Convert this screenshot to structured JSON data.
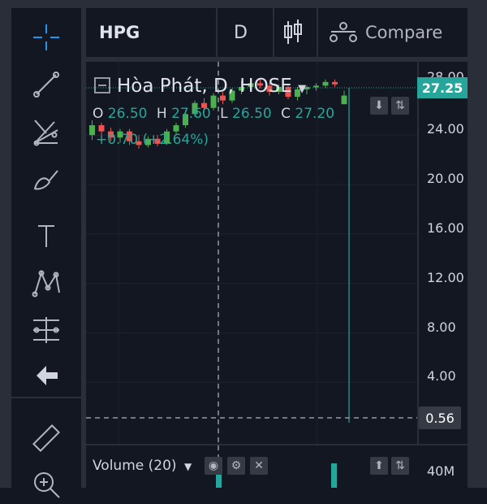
{
  "header": {
    "symbol": "HPG",
    "interval": "D",
    "compare_label": "Compare"
  },
  "legend": {
    "title": "Hòa Phát, D, HOSE",
    "open_key": "O",
    "open": "26.50",
    "high_key": "H",
    "high": "27.60",
    "low_key": "L",
    "low": "26.50",
    "close_key": "C",
    "close": "27.20",
    "change": "+0.70 (+2.64%)"
  },
  "price_axis": {
    "ticks": [
      "28.00",
      "24.00",
      "20.00",
      "16.00",
      "12.00",
      "8.00",
      "4.00"
    ],
    "last_price": "27.25",
    "crosshair_price": "0.56"
  },
  "volume_pane": {
    "label": "Volume (20)",
    "axis_tick": "40M"
  },
  "colors": {
    "up": "#26a69a",
    "down": "#ef5350",
    "up_bright": "#4caf50",
    "background": "#131722",
    "grid": "#1e222d"
  },
  "tools": [
    "crosshair-icon",
    "trendline-icon",
    "fib-icon",
    "brush-icon",
    "text-icon",
    "pattern-icon",
    "prediction-icon",
    "back-arrow-icon",
    "ruler-icon",
    "zoom-icon"
  ],
  "chart_data": {
    "type": "candlestick",
    "ohlc": [
      {
        "o": 24.0,
        "h": 25.2,
        "l": 23.6,
        "c": 24.8
      },
      {
        "o": 24.8,
        "h": 25.0,
        "l": 24.0,
        "c": 24.3
      },
      {
        "o": 24.3,
        "h": 24.6,
        "l": 23.5,
        "c": 23.8
      },
      {
        "o": 23.8,
        "h": 24.5,
        "l": 23.4,
        "c": 24.3
      },
      {
        "o": 24.3,
        "h": 24.5,
        "l": 23.2,
        "c": 23.5
      },
      {
        "o": 23.5,
        "h": 24.0,
        "l": 22.9,
        "c": 23.2
      },
      {
        "o": 23.2,
        "h": 23.9,
        "l": 23.0,
        "c": 23.7
      },
      {
        "o": 23.7,
        "h": 24.0,
        "l": 23.1,
        "c": 23.3
      },
      {
        "o": 23.3,
        "h": 24.5,
        "l": 23.2,
        "c": 24.3
      },
      {
        "o": 24.3,
        "h": 25.0,
        "l": 24.0,
        "c": 24.8
      },
      {
        "o": 24.8,
        "h": 25.9,
        "l": 24.6,
        "c": 25.7
      },
      {
        "o": 25.7,
        "h": 26.8,
        "l": 25.5,
        "c": 26.6
      },
      {
        "o": 26.6,
        "h": 27.0,
        "l": 25.9,
        "c": 26.2
      },
      {
        "o": 26.2,
        "h": 27.4,
        "l": 26.0,
        "c": 27.2
      },
      {
        "o": 27.2,
        "h": 27.5,
        "l": 26.5,
        "c": 26.8
      },
      {
        "o": 26.8,
        "h": 27.8,
        "l": 26.6,
        "c": 27.6
      },
      {
        "o": 27.6,
        "h": 28.4,
        "l": 27.3,
        "c": 27.9
      },
      {
        "o": 27.9,
        "h": 28.3,
        "l": 27.5,
        "c": 28.2
      },
      {
        "o": 28.2,
        "h": 28.6,
        "l": 27.8,
        "c": 28.0
      },
      {
        "o": 28.0,
        "h": 28.2,
        "l": 27.2,
        "c": 27.5
      },
      {
        "o": 27.5,
        "h": 28.1,
        "l": 27.3,
        "c": 27.9
      },
      {
        "o": 27.9,
        "h": 28.0,
        "l": 26.9,
        "c": 27.1
      },
      {
        "o": 27.1,
        "h": 27.9,
        "l": 26.8,
        "c": 27.7
      },
      {
        "o": 27.7,
        "h": 28.0,
        "l": 27.3,
        "c": 27.9
      },
      {
        "o": 27.9,
        "h": 28.2,
        "l": 27.6,
        "c": 28.0
      },
      {
        "o": 28.0,
        "h": 28.5,
        "l": 27.8,
        "c": 28.3
      },
      {
        "o": 28.3,
        "h": 28.5,
        "l": 27.9,
        "c": 28.1
      },
      {
        "o": 26.5,
        "h": 27.6,
        "l": 26.5,
        "c": 27.2
      }
    ],
    "ylim": [
      0,
      30
    ],
    "volume_ylim": [
      0,
      50
    ]
  }
}
